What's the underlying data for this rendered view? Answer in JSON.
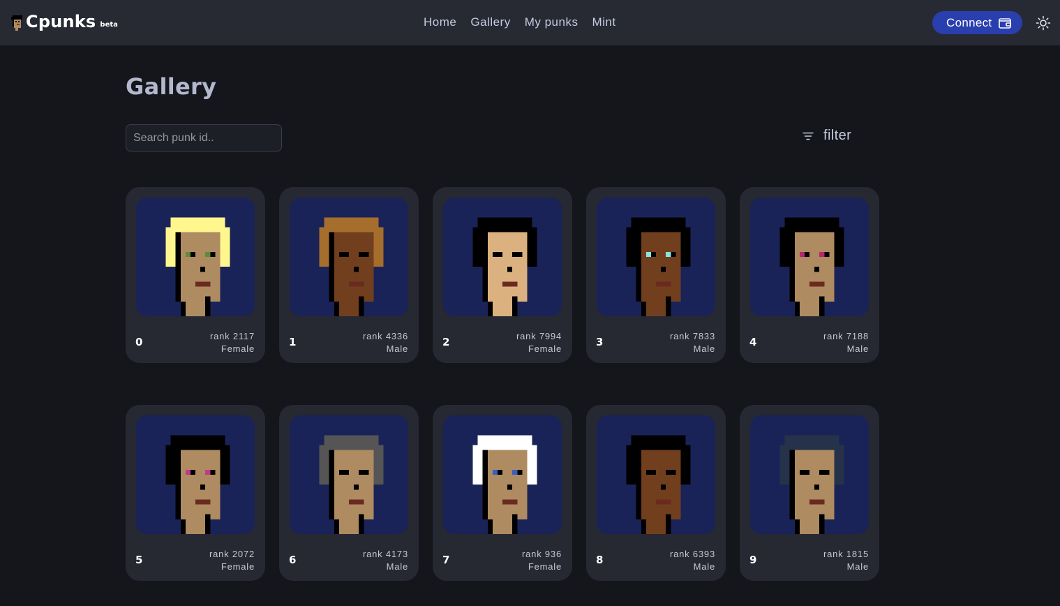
{
  "header": {
    "brand": "Cpunks",
    "badge": "beta",
    "nav": [
      "Home",
      "Gallery",
      "My punks",
      "Mint"
    ],
    "connect_label": "Connect",
    "icons": {
      "logo": "punk-logo-icon",
      "wallet": "wallet-icon",
      "theme": "sun-icon"
    }
  },
  "page": {
    "title": "Gallery",
    "search_placeholder": "Search punk id..",
    "filter_label": "filter"
  },
  "colors": {
    "background": "#15161b",
    "header": "#272a33",
    "card": "#262832",
    "image_bg": "#1a2358",
    "accent": "#2a3fae"
  },
  "punks": [
    {
      "id": "0",
      "rank": "rank 2117",
      "gender": "Female",
      "skin": "#ae8b61",
      "hair": "#fff68e",
      "eyes": "#5e8c3a"
    },
    {
      "id": "1",
      "rank": "rank 4336",
      "gender": "Male",
      "skin": "#713f1d",
      "hair": "#a66e2c",
      "eyes": "#000000"
    },
    {
      "id": "2",
      "rank": "rank 7994",
      "gender": "Female",
      "skin": "#dbb180",
      "hair": "#000000",
      "eyes": "#000000"
    },
    {
      "id": "3",
      "rank": "rank 7833",
      "gender": "Male",
      "skin": "#713f1d",
      "hair": "#000000",
      "eyes": "#8ae5e1"
    },
    {
      "id": "4",
      "rank": "rank 7188",
      "gender": "Male",
      "skin": "#ae8b61",
      "hair": "#000000",
      "eyes": "#b8276f"
    },
    {
      "id": "5",
      "rank": "rank 2072",
      "gender": "Female",
      "skin": "#ae8b61",
      "hair": "#000000",
      "eyes": "#c13a8a"
    },
    {
      "id": "6",
      "rank": "rank 4173",
      "gender": "Male",
      "skin": "#ae8b61",
      "hair": "#555555",
      "eyes": "#000000"
    },
    {
      "id": "7",
      "rank": "rank 936",
      "gender": "Female",
      "skin": "#ae8b61",
      "hair": "#ffffff",
      "eyes": "#3a5fbf"
    },
    {
      "id": "8",
      "rank": "rank 6393",
      "gender": "Male",
      "skin": "#713f1d",
      "hair": "#000000",
      "eyes": "#000000"
    },
    {
      "id": "9",
      "rank": "rank 1815",
      "gender": "Male",
      "skin": "#ae8b61",
      "hair": "#26314a",
      "eyes": "#000000"
    }
  ]
}
